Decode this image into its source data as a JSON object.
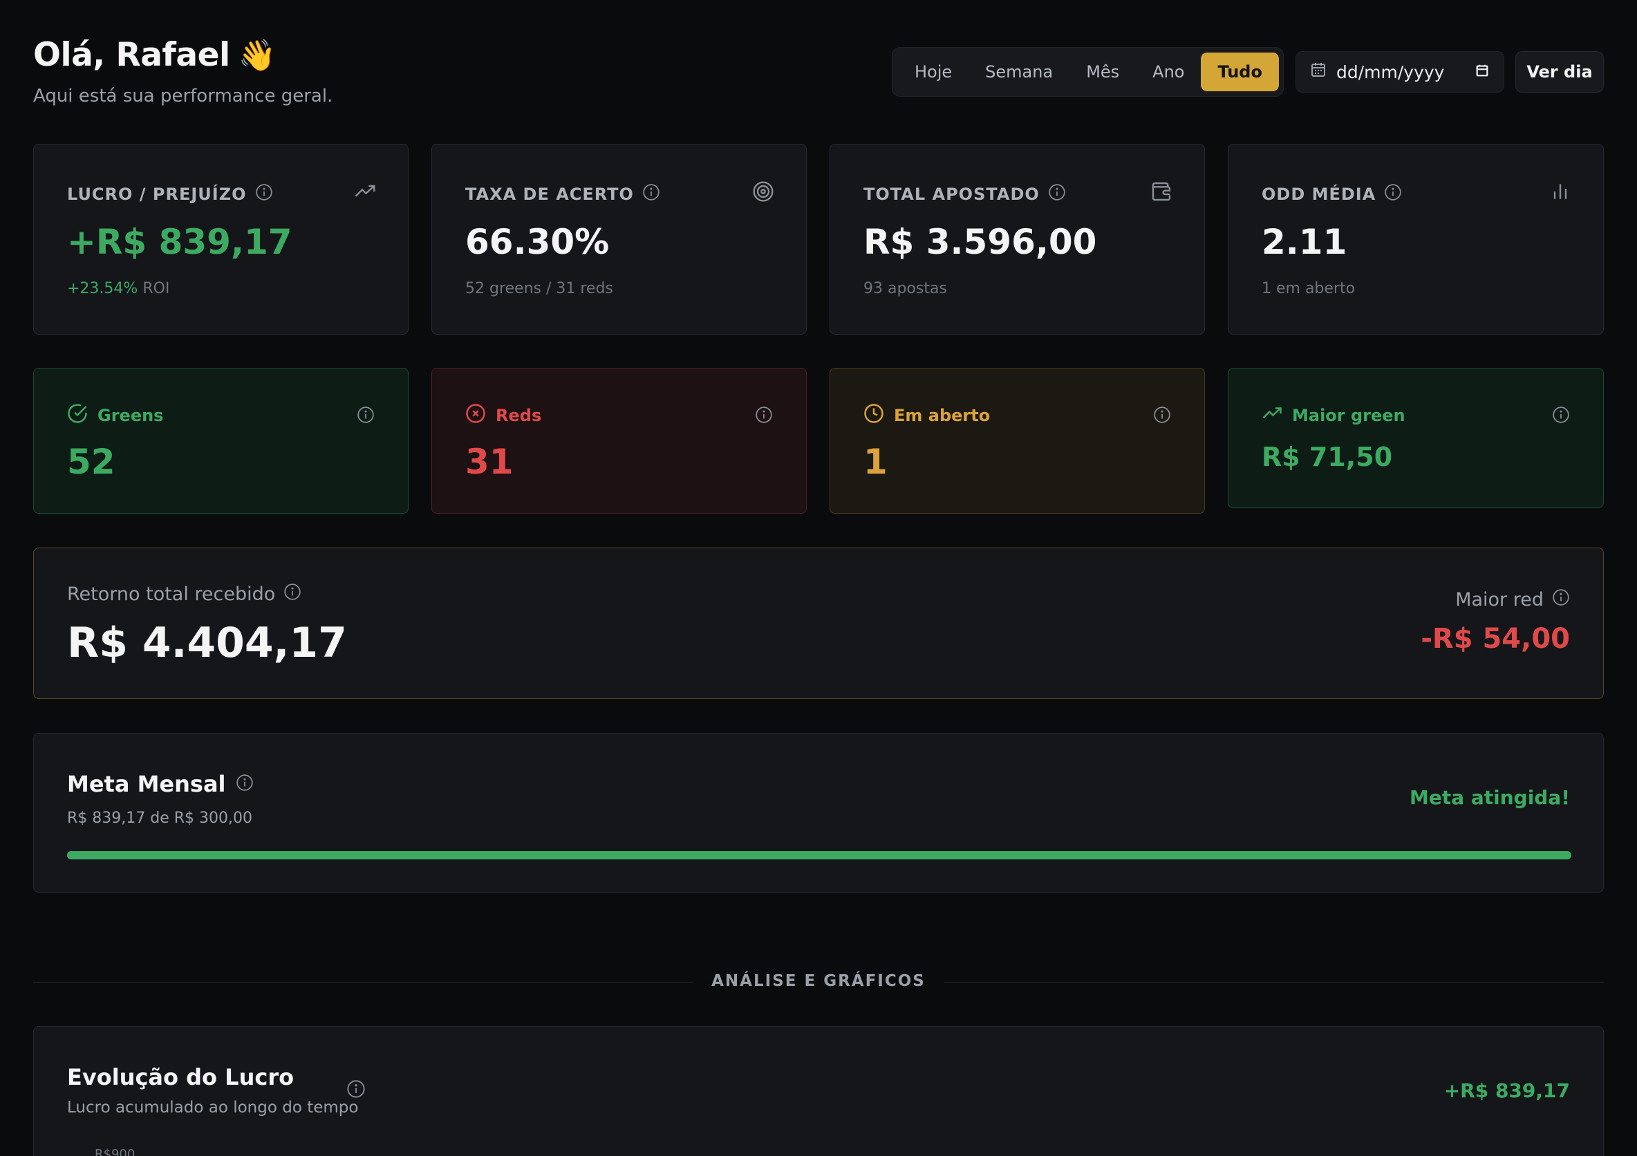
{
  "header": {
    "greeting": "Olá, Rafael",
    "wave": "👋",
    "subtitle": "Aqui está sua performance geral."
  },
  "period_filter": {
    "options": [
      "Hoje",
      "Semana",
      "Mês",
      "Ano",
      "Tudo"
    ],
    "selected": "Tudo"
  },
  "date_picker": {
    "placeholder": "dd/mm/yyyy"
  },
  "ver_dia_label": "Ver dia",
  "stats": {
    "profit": {
      "label": "LUCRO / PREJUÍZO",
      "value": "+R$ 839,17",
      "roi": "+23.54%",
      "roi_label": "ROI",
      "icon": "trending-up-icon"
    },
    "hit_rate": {
      "label": "TAXA DE ACERTO",
      "value": "66.30%",
      "sub": "52 greens / 31 reds",
      "icon": "target-icon"
    },
    "total_bet": {
      "label": "TOTAL APOSTADO",
      "value": "R$ 3.596,00",
      "sub": "93 apostas",
      "icon": "wallet-icon"
    },
    "avg_odd": {
      "label": "ODD MÉDIA",
      "value": "2.11",
      "sub": "1 em aberto",
      "icon": "bar-chart-icon"
    }
  },
  "mini_stats": {
    "greens": {
      "label": "Greens",
      "value": "52",
      "color": "#3daa62"
    },
    "reds": {
      "label": "Reds",
      "value": "31",
      "color": "#e0494a"
    },
    "open": {
      "label": "Em aberto",
      "value": "1",
      "color": "#dba33a"
    },
    "biggest_green": {
      "label": "Maior green",
      "value": "R$ 71,50",
      "color": "#3daa62"
    }
  },
  "return": {
    "label": "Retorno total recebido",
    "value": "R$ 4.404,17",
    "biggest_red_label": "Maior red",
    "biggest_red_value": "-R$ 54,00"
  },
  "goal": {
    "title": "Meta Mensal",
    "progress_text": "R$ 839,17 de R$ 300,00",
    "status": "Meta atingida!",
    "progress_fraction": 1.0
  },
  "section": {
    "title": "ANÁLISE E GRÁFICOS"
  },
  "profit_chart": {
    "title": "Evolução do Lucro",
    "subtitle": "Lucro acumulado ao longo do tempo",
    "value": "+R$ 839,17",
    "first_tick": "R$900"
  },
  "colors": {
    "accent": "#d4a537",
    "green": "#3daa62",
    "red": "#e0494a",
    "amber": "#dba33a",
    "background": "#0a0b0d",
    "card": "#14161a"
  }
}
